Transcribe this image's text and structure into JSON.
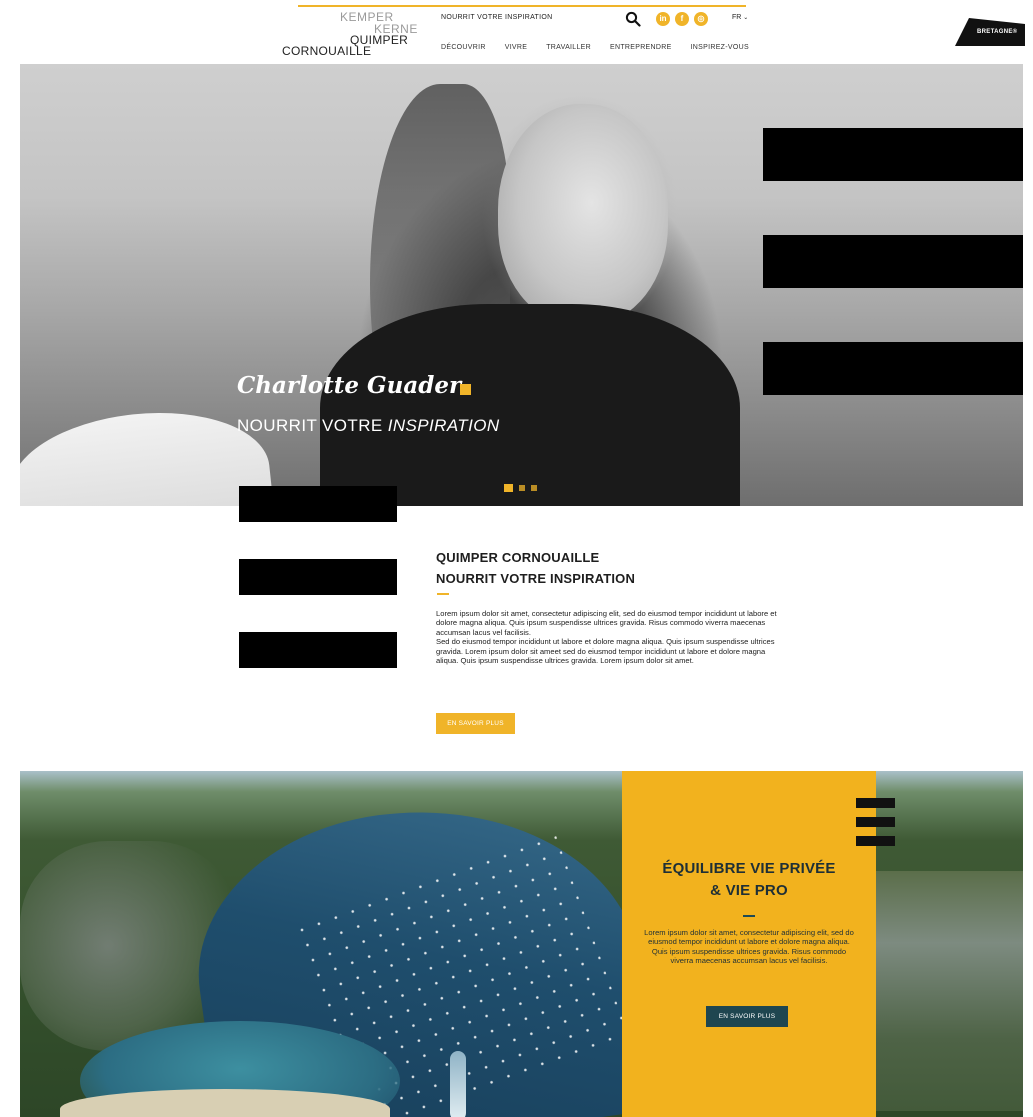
{
  "header": {
    "logo": {
      "line1": "KEMPER",
      "line2": "KERNE",
      "line3": "QUIMPER",
      "line4": "CORNOUAILLE"
    },
    "tagline": "NOURRIT VOTRE INSPIRATION",
    "search_icon": "search-icon",
    "social": [
      {
        "name": "linkedin-icon",
        "glyph": "in"
      },
      {
        "name": "facebook-icon",
        "glyph": "f"
      },
      {
        "name": "instagram-icon",
        "glyph": "◎"
      }
    ],
    "language": "FR",
    "nav": [
      {
        "label": "DÉCOUVRIR"
      },
      {
        "label": "VIVRE"
      },
      {
        "label": "TRAVAILLER"
      },
      {
        "label": "ENTREPRENDRE"
      },
      {
        "label": "INSPIREZ-VOUS"
      }
    ],
    "partner_badge": "BRETAGNE®"
  },
  "hero": {
    "name": "Charlotte Guader",
    "tagline_main": "NOURRIT VOTRE ",
    "tagline_em": "INSPIRATION",
    "slides": 3,
    "active_slide": 1
  },
  "intro": {
    "title_line1": "QUIMPER CORNOUAILLE",
    "title_line2": "NOURRIT VOTRE INSPIRATION",
    "body_p1": "Lorem ipsum dolor sit amet, consectetur adipiscing elit, sed do eiusmod tempor incididunt ut labore et dolore magna aliqua. Quis ipsum suspendisse ultrices gravida. Risus commodo viverra maecenas accumsan lacus vel facilisis.",
    "body_p2": "Sed do eiusmod tempor incididunt ut labore et dolore magna aliqua. Quis ipsum suspendisse ultrices gravida. Lorem ipsum dolor sit ameet sed do eiusmod tempor incididunt ut labore et dolore magna aliqua. Quis ipsum suspendisse ultrices gravida. Lorem ipsum dolor sit amet.",
    "cta": "EN SAVOIR PLUS"
  },
  "feature": {
    "title_line1": "ÉQUILIBRE VIE PRIVÉE",
    "title_line2": "& VIE PRO",
    "body": "Lorem ipsum dolor sit amet, consectetur adipiscing elit, sed do eiusmod tempor incididunt ut labore et dolore magna aliqua. Quis ipsum suspendisse ultrices gravida. Risus commodo viverra maecenas accumsan lacus vel facilisis.",
    "cta": "EN SAVOIR PLUS"
  },
  "colors": {
    "accent": "#f0b429",
    "card": "#f2b21e",
    "dark_teal": "#1f4650",
    "redaction": "#000000"
  }
}
